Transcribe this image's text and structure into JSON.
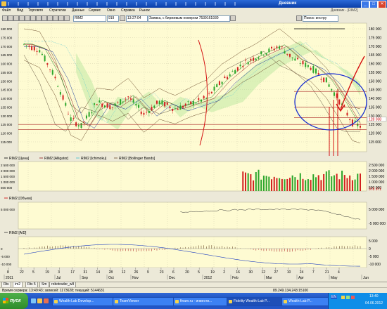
{
  "window": {
    "title": "Дневник",
    "controls": {
      "minimize": "_",
      "maximize": "□",
      "close": "✕"
    }
  },
  "menu": {
    "items": [
      "Файл",
      "Вид",
      "Торговля",
      "Стратегии",
      "Данные",
      "Сервис",
      "Окно",
      "Справка",
      "Рынок"
    ],
    "right": "Дневник - [RIM2]"
  },
  "toolbar": {
    "symbol_value": "RIM2",
    "code_value": "919",
    "time_value": "13:27:04",
    "message": "Заявка, с биржевым номером 7539161930",
    "search_label": "Поиск: инстру"
  },
  "panes": {
    "price": {
      "yticks": [
        "180 000",
        "175 000",
        "170 000",
        "165 000",
        "160 000",
        "155 000",
        "150 000",
        "145 000",
        "140 000",
        "135 000",
        "130 000",
        "125 000",
        "120 000",
        "115 000"
      ],
      "current_price": "128 038",
      "legend": [
        "RIM2 [Цена]",
        "RIM2 [Alligator]",
        "RIM2 [Ichimoku]",
        "RIM2 [Bollinger Bands]"
      ]
    },
    "volume": {
      "yticks": [
        "2 500 000",
        "2 000 000",
        "1 500 000",
        "1 000 000",
        "500 000"
      ],
      "left_ticks": [
        "2 500 000",
        "2 000 000",
        "1 500 000",
        "1 000 000",
        "500 000"
      ],
      "current": "978 971",
      "legend": [
        "RIM2 [Объем]"
      ]
    },
    "ad": {
      "yticks": [
        "5 000 000",
        "-5 000 000"
      ],
      "left_ticks": [
        "5 000 000"
      ],
      "legend": [
        "RIM2 [A/D]"
      ]
    },
    "macd": {
      "yticks": [
        "5 000",
        "0",
        "-5 000",
        "-10 000"
      ],
      "left_ticks": [
        "0",
        "-5 000",
        "-10 000"
      ],
      "legend": [
        "RIM2 [MACD Histogram]",
        "RIM2 [MACD]"
      ]
    }
  },
  "date_axis": {
    "days": [
      "8",
      "22",
      "5",
      "19",
      "3",
      "17",
      "31",
      "14",
      "28",
      "12",
      "26",
      "9",
      "23",
      "6",
      "20",
      "5",
      "19",
      "2",
      "16",
      "30",
      "12",
      "27",
      "10",
      "24",
      "7",
      "21",
      "4"
    ],
    "months": [
      "2011",
      "Jul",
      "Sep",
      "Oct",
      "Nov",
      "Dec",
      "2012",
      "Feb",
      "Mar",
      "Apr",
      "May",
      "Jun"
    ]
  },
  "tabs": [
    "Rts",
    "im2",
    "Rts 5",
    "Sm",
    "robotrader_w9"
  ],
  "status": {
    "left": "Время сервера: 13:49:43; записей: 1173628; текущий: 5144631",
    "right": "89.249.134.243:15100"
  },
  "taskbar": {
    "start": "пуск",
    "windows": [
      "Wealth-Lab Develop...",
      "TeamViewer",
      "finam.ru - инвести...",
      "Fidelity Wealth-Lab P...",
      "Wealth-Lab P..."
    ],
    "lang": "EN",
    "clock": "13:40",
    "date": "04.06.2012"
  },
  "colors": {
    "chart_bg": "#fefbd2",
    "bull_candle": "#2aa52a",
    "bear_candle": "#d22020",
    "annotation_blue": "#1a2fd0",
    "annotation_red": "#d41010"
  }
}
